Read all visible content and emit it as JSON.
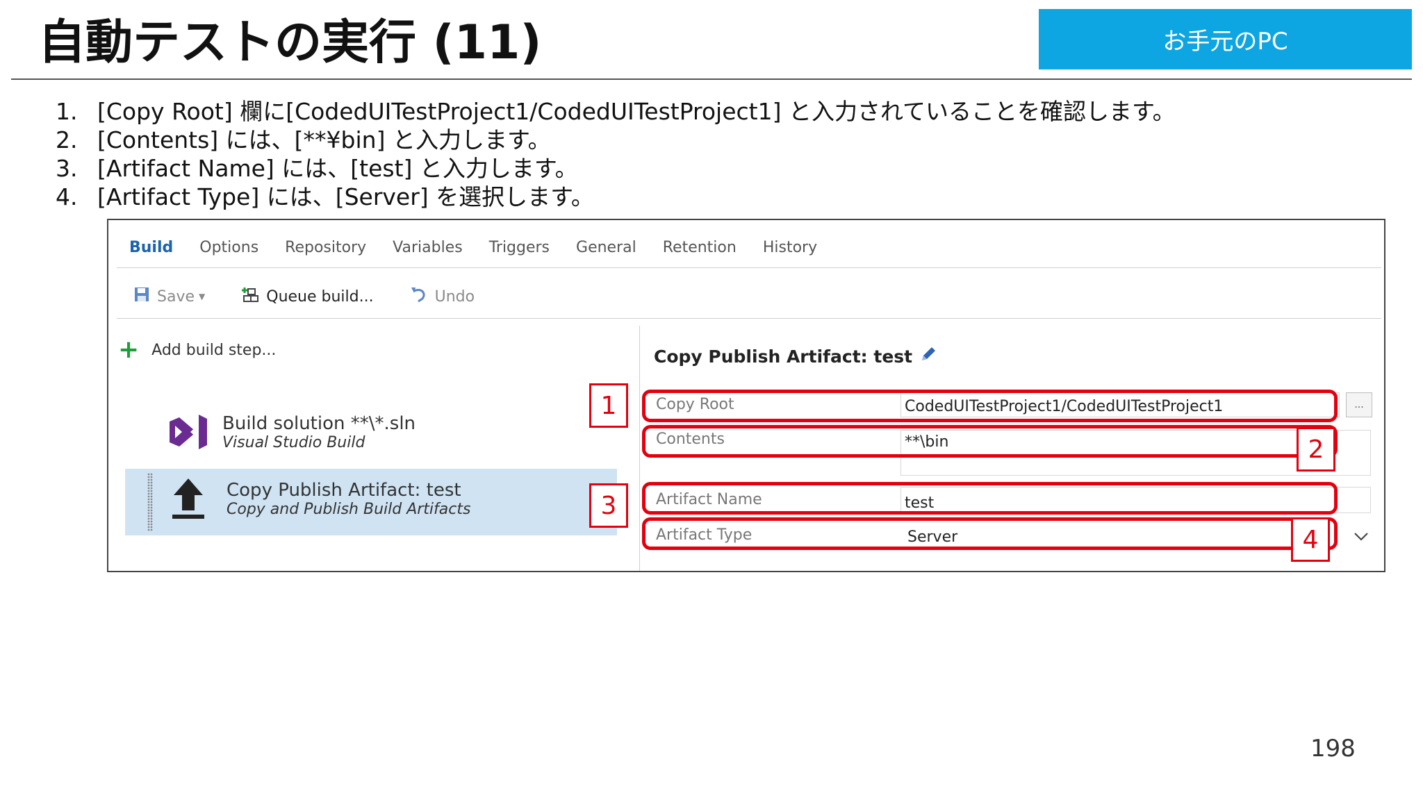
{
  "slide": {
    "title": "自動テストの実行 (11)",
    "badge": "お手元のPC",
    "page_number": "198"
  },
  "instructions": [
    {
      "num": "1.",
      "text": "[Copy Root] 欄に[CodedUITestProject1/CodedUITestProject1] と入力されていることを確認します。"
    },
    {
      "num": "2.",
      "text": "[Contents] には、[**¥bin] と入力します。"
    },
    {
      "num": "3.",
      "text": "[Artifact Name] には、[test] と入力します。"
    },
    {
      "num": "4.",
      "text": "[Artifact Type] には、[Server] を選択します。"
    }
  ],
  "tabs": [
    "Build",
    "Options",
    "Repository",
    "Variables",
    "Triggers",
    "General",
    "Retention",
    "History"
  ],
  "active_tab": "Build",
  "toolbar": {
    "save": "Save",
    "queue": "Queue build...",
    "undo": "Undo"
  },
  "left_panel": {
    "add_step": "Add build step...",
    "tasks": [
      {
        "name": "Build solution **\\*.sln",
        "sub": "Visual Studio Build"
      },
      {
        "name": "Copy Publish Artifact: test",
        "sub": "Copy and Publish Build Artifacts"
      }
    ]
  },
  "right_panel": {
    "title": "Copy Publish Artifact: test",
    "fields": [
      {
        "label": "Copy Root",
        "value": "CodedUITestProject1/CodedUITestProject1"
      },
      {
        "label": "Contents",
        "value": "**\\bin"
      },
      {
        "label": "Artifact Name",
        "value": "test"
      },
      {
        "label": "Artifact Type",
        "value": "Server"
      }
    ],
    "browse": "..."
  },
  "callouts": [
    "1",
    "2",
    "3",
    "4"
  ],
  "colors": {
    "accent": "#0ea5e3",
    "highlight": "#e3000f",
    "active_tab": "#1a63b0",
    "selected_row": "#cfe3f3"
  }
}
